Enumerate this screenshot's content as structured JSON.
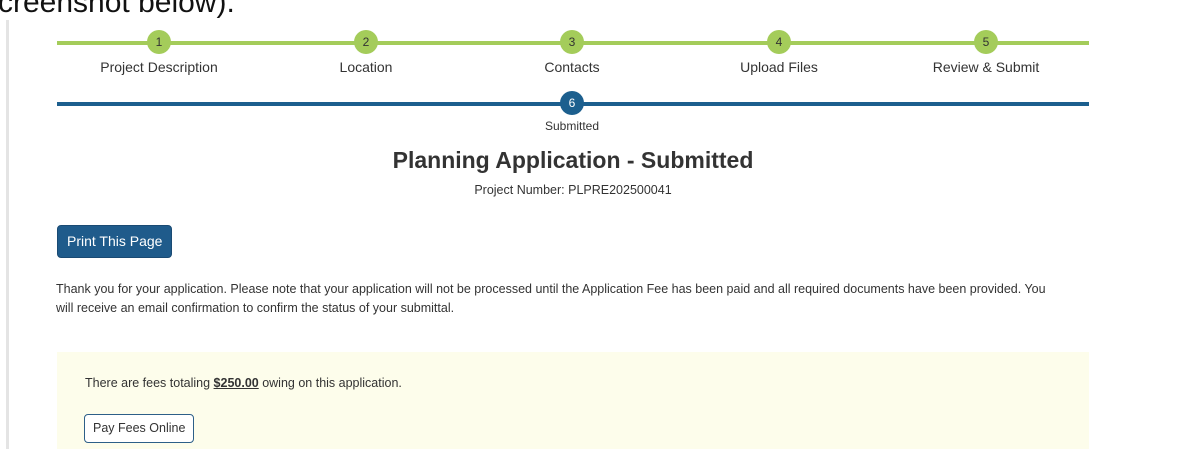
{
  "caption": "creenshot below).",
  "colors": {
    "progress_green": "#a4cc5a",
    "progress_blue": "#1c5f8e",
    "button_blue": "#1f5b8b",
    "fee_background": "#fdfdeb"
  },
  "stepper": {
    "steps": [
      {
        "number": "1",
        "label": "Project Description"
      },
      {
        "number": "2",
        "label": "Location"
      },
      {
        "number": "3",
        "label": "Contacts"
      },
      {
        "number": "4",
        "label": "Upload Files"
      },
      {
        "number": "5",
        "label": "Review & Submit"
      }
    ],
    "final_step": {
      "number": "6",
      "label": "Submitted"
    }
  },
  "page": {
    "title": "Planning Application - Submitted",
    "project_number": "Project Number: PLPRE202500041"
  },
  "actions": {
    "print_label": "Print This Page"
  },
  "message": "Thank you for your application. Please note that your application will not be processed until the Application Fee has been paid and all required documents have been provided. You will receive an email confirmation to confirm the status of your submittal.",
  "fees": {
    "text_before": "There are fees totaling ",
    "amount": "$250.00",
    "text_after": " owing on this application.",
    "pay_label": "Pay Fees Online"
  }
}
